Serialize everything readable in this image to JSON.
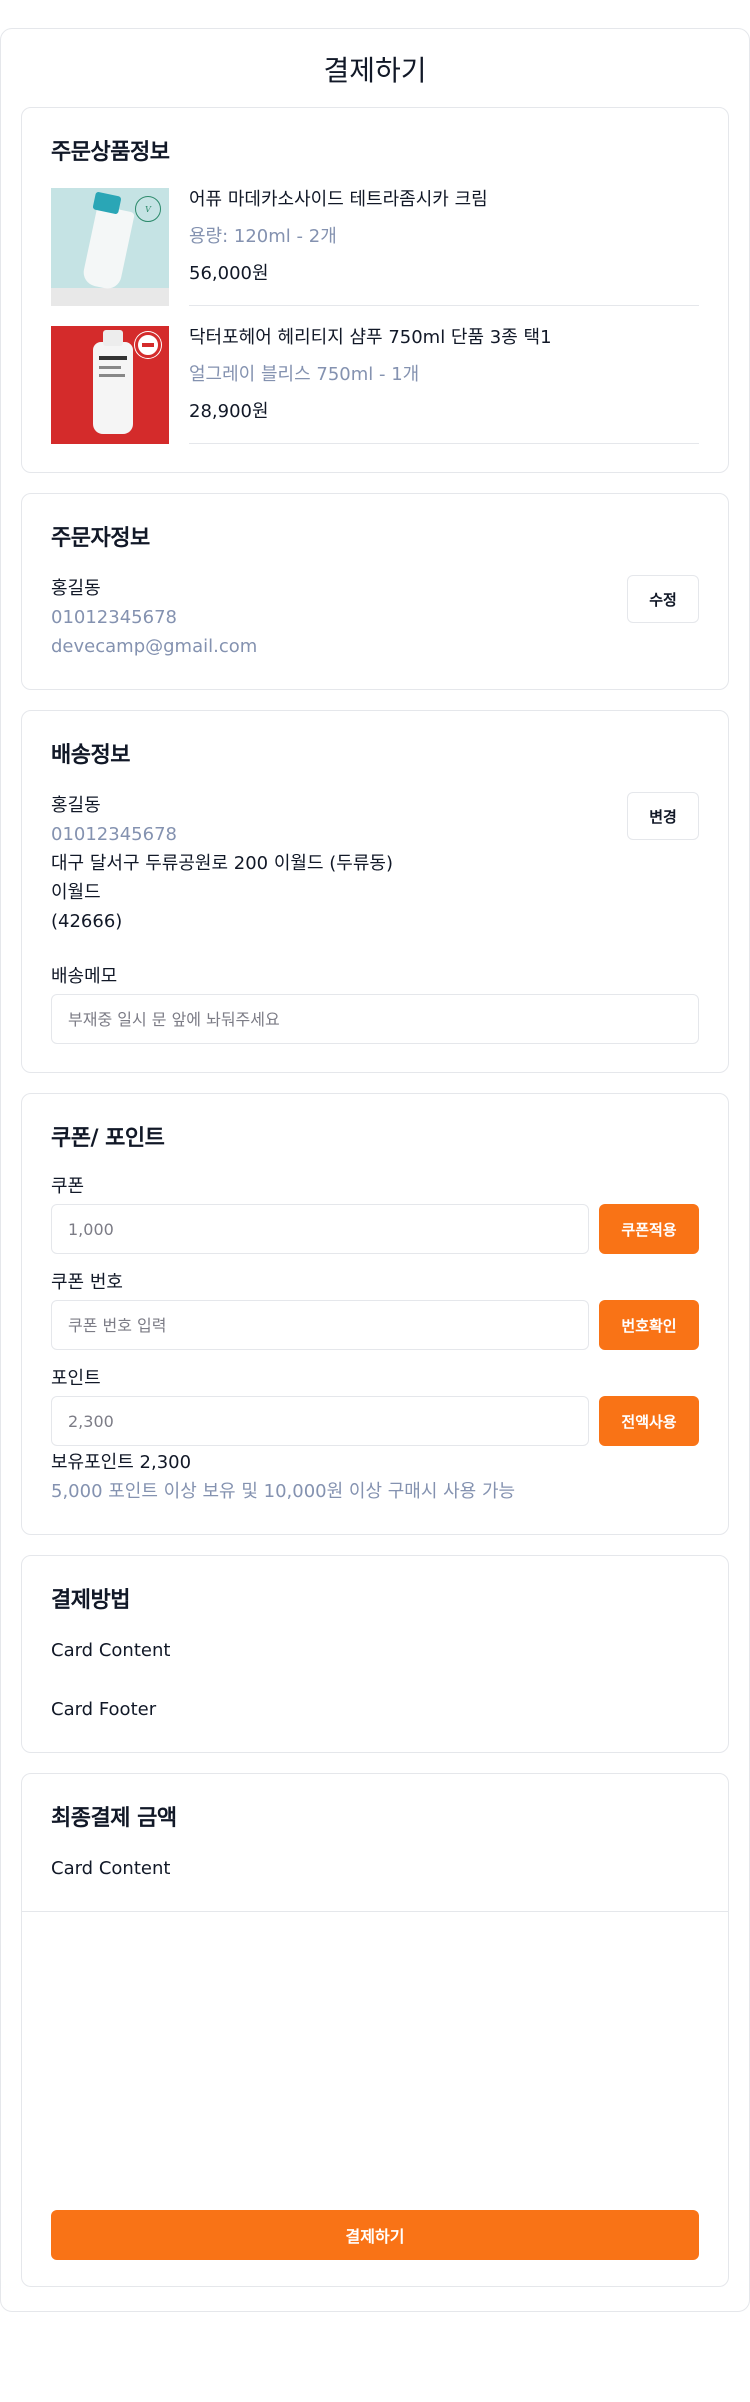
{
  "page": {
    "title": "결제하기"
  },
  "order_items": {
    "title": "주문상품정보",
    "items": [
      {
        "name": "어퓨 마데카소사이드 테트라좀시카 크림",
        "option": "용량: 120ml - 2개",
        "price": "56,000원"
      },
      {
        "name": "닥터포헤어 헤리티지 샴푸 750ml 단품 3종 택1",
        "option": "얼그레이 블리스 750ml - 1개",
        "price": "28,900원"
      }
    ]
  },
  "orderer": {
    "title": "주문자정보",
    "name": "홍길동",
    "phone": "01012345678",
    "email": "devecamp@gmail.com",
    "edit_label": "수정"
  },
  "shipping": {
    "title": "배송정보",
    "name": "홍길동",
    "phone": "01012345678",
    "address": "대구 달서구 두류공원로 200 이월드 (두류동)",
    "address_detail": "이월드",
    "zipcode": "(42666)",
    "change_label": "변경",
    "memo_label": "배송메모",
    "memo_placeholder": "부재중 일시 문 앞에 놔둬주세요"
  },
  "coupon_point": {
    "title": "쿠폰/ 포인트",
    "coupon_label": "쿠폰",
    "coupon_value": "1,000",
    "coupon_button": "쿠폰적용",
    "code_label": "쿠폰 번호",
    "code_placeholder": "쿠폰 번호 입력",
    "code_button": "번호확인",
    "point_label": "포인트",
    "point_value": "2,300",
    "point_button": "전액사용",
    "owned_points": "보유포인트 2,300",
    "point_notice": "5,000 포인트 이상 보유 및 10,000원 이상 구매시 사용 가능"
  },
  "payment_method": {
    "title": "결제방법",
    "content": "Card Content",
    "footer": "Card Footer"
  },
  "final_amount": {
    "title": "최종결제 금액",
    "content": "Card Content",
    "pay_button": "결제하기"
  },
  "colors": {
    "accent": "#f97316",
    "muted": "#8492b0",
    "border": "#e5e7eb"
  }
}
